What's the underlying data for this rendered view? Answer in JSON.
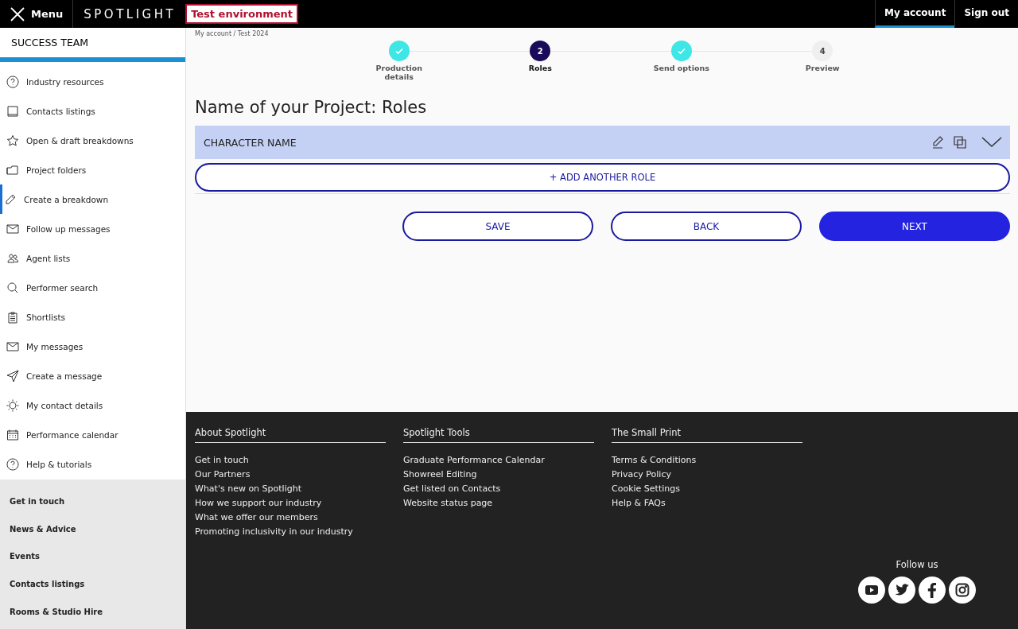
{
  "topbar": {
    "menu": "Menu",
    "logo": "SPOTLIGHT",
    "environment": "Test environment",
    "nav": [
      {
        "label": "My account",
        "selected": true
      },
      {
        "label": "Sign out",
        "selected": false
      }
    ]
  },
  "sidebar": {
    "title": "SUCCESS TEAM",
    "items": [
      {
        "label": "Industry resources",
        "selected": false
      },
      {
        "label": "Contacts listings",
        "selected": false
      },
      {
        "label": "Open & draft breakdowns",
        "selected": false
      },
      {
        "label": "Project folders",
        "selected": false
      },
      {
        "label": "Create a breakdown",
        "selected": true
      },
      {
        "label": "Follow up messages",
        "selected": false
      },
      {
        "label": "Agent lists",
        "selected": false
      },
      {
        "label": "Performer search",
        "selected": false
      },
      {
        "label": "Shortlists",
        "selected": false
      },
      {
        "label": "My messages",
        "selected": false
      },
      {
        "label": "Create a message",
        "selected": false
      },
      {
        "label": "My contact details",
        "selected": false
      },
      {
        "label": "Performance calendar",
        "selected": false
      },
      {
        "label": "Help & tutorials",
        "selected": false
      }
    ],
    "links": [
      "Get in touch",
      "News & Advice",
      "Events",
      "Contacts listings",
      "Rooms & Studio Hire"
    ]
  },
  "breadcrumb": "My account / Test 2024",
  "steps": [
    {
      "label": "Production details",
      "kind": "done"
    },
    {
      "label": "Roles",
      "number": "2",
      "kind": "current"
    },
    {
      "label": "Send options",
      "kind": "done"
    },
    {
      "label": "Preview",
      "number": "4",
      "kind": "todo"
    }
  ],
  "title": "Name of your Project: Roles",
  "roles": [
    {
      "name": "CHARACTER NAME"
    }
  ],
  "add_role": "+ ADD ANOTHER ROLE",
  "buttons": [
    {
      "label": "SAVE",
      "kind": "outline"
    },
    {
      "label": "BACK",
      "kind": "outline"
    },
    {
      "label": "NEXT",
      "kind": "primary"
    }
  ],
  "footer": {
    "columns": [
      {
        "heading": "About Spotlight",
        "links": [
          "Get in touch",
          "Our Partners",
          "What's new on Spotlight",
          "How we support our industry",
          "What we offer our members",
          "Promoting inclusivity in our industry"
        ]
      },
      {
        "heading": "Spotlight Tools",
        "links": [
          "Graduate Performance Calendar",
          "Showreel Editing",
          "Get listed on Contacts",
          "Website status page"
        ]
      },
      {
        "heading": "The Small Print",
        "links": [
          "Terms & Conditions",
          "Privacy Policy",
          "Cookie Settings",
          "Help & FAQs"
        ]
      }
    ],
    "follow": "Follow us"
  }
}
